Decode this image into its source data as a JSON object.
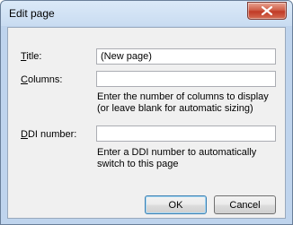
{
  "dialog": {
    "title": "Edit page",
    "close_icon": "close-icon"
  },
  "form": {
    "title_label_first": "T",
    "title_label_rest": "itle:",
    "title_value": "(New page)",
    "columns_label_first": "C",
    "columns_label_rest": "olumns:",
    "columns_value": "",
    "columns_hint": "Enter the number of columns to display (or leave blank for automatic sizing)",
    "ddi_label_first": "D",
    "ddi_label_rest": "DI number:",
    "ddi_value": "",
    "ddi_hint": "Enter a DDI number to automatically switch to this page"
  },
  "buttons": {
    "ok": "OK",
    "cancel": "Cancel"
  }
}
